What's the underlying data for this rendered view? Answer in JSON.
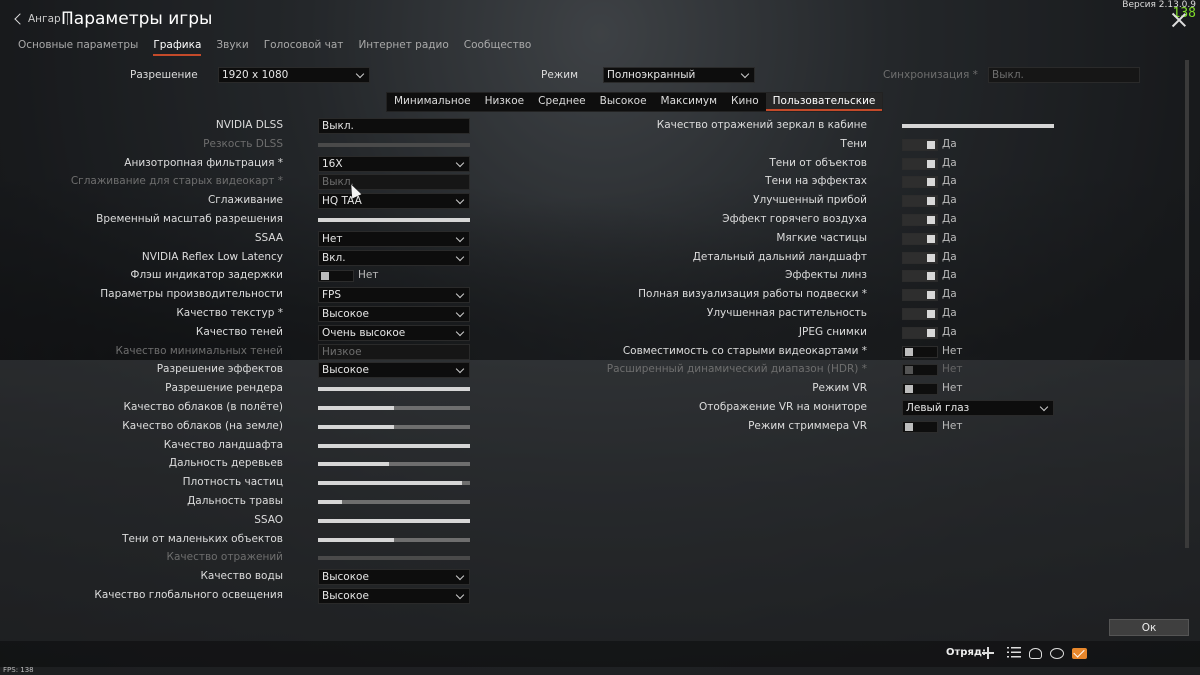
{
  "header": {
    "back_label": "Ангар",
    "title": "Параметры игры",
    "version": "Версия 2.13.0.9",
    "fps_counter": "138"
  },
  "tabs": [
    "Основные параметры",
    "Графика",
    "Звуки",
    "Голосовой чат",
    "Интернет радио",
    "Сообщество"
  ],
  "top_row": {
    "resolution_label": "Разрешение",
    "resolution_value": "1920 x 1080",
    "mode_label": "Режим",
    "mode_value": "Полноэкранный",
    "sync_label": "Синхронизация *",
    "sync_value": "Выкл."
  },
  "presets": [
    "Минимальное",
    "Низкое",
    "Среднее",
    "Высокое",
    "Максимум",
    "Кино",
    "Пользовательские"
  ],
  "left_settings": [
    {
      "label": "NVIDIA DLSS",
      "type": "field",
      "value": "Выкл."
    },
    {
      "label": "Резкость DLSS",
      "type": "slider",
      "value": 0,
      "disabled": true
    },
    {
      "label": "Анизотропная фильтрация *",
      "type": "dropdown",
      "value": "16X"
    },
    {
      "label": "Сглаживание для старых видеокарт *",
      "type": "field",
      "value": "Выкл.",
      "disabled": true
    },
    {
      "label": "Сглаживание",
      "type": "dropdown",
      "value": "HQ TAA"
    },
    {
      "label": "Временный масштаб разрешения",
      "type": "slider",
      "value": 1.0
    },
    {
      "label": "SSAA",
      "type": "dropdown",
      "value": "Нет"
    },
    {
      "label": "NVIDIA Reflex Low Latency",
      "type": "dropdown",
      "value": "Вкл."
    },
    {
      "label": "Флэш индикатор задержки",
      "type": "toggle",
      "value": "Нет",
      "on": false
    },
    {
      "label": "Параметры производительности",
      "type": "dropdown",
      "value": "FPS"
    },
    {
      "label": "Качество текстур *",
      "type": "dropdown",
      "value": "Высокое"
    },
    {
      "label": "Качество теней",
      "type": "dropdown",
      "value": "Очень высокое"
    },
    {
      "label": "Качество минимальных теней",
      "type": "field",
      "value": "Низкое",
      "disabled": true
    },
    {
      "label": "Разрешение эффектов",
      "type": "dropdown",
      "value": "Высокое"
    },
    {
      "label": "Разрешение рендера",
      "type": "slider",
      "value": 1.0
    },
    {
      "label": "Качество облаков (в полёте)",
      "type": "slider",
      "value": 0.5
    },
    {
      "label": "Качество облаков (на земле)",
      "type": "slider",
      "value": 0.5
    },
    {
      "label": "Качество ландшафта",
      "type": "slider",
      "value": 1.0
    },
    {
      "label": "Дальность деревьев",
      "type": "slider",
      "value": 0.47
    },
    {
      "label": "Плотность частиц",
      "type": "slider",
      "value": 0.95
    },
    {
      "label": "Дальность травы",
      "type": "slider",
      "value": 0.16
    },
    {
      "label": "SSAO",
      "type": "slider",
      "value": 1.0
    },
    {
      "label": "Тени от маленьких объектов",
      "type": "slider",
      "value": 0.5
    },
    {
      "label": "Качество отражений",
      "type": "slider",
      "value": 0,
      "disabled": true
    },
    {
      "label": "Качество воды",
      "type": "dropdown",
      "value": "Высокое"
    },
    {
      "label": "Качество глобального освещения",
      "type": "dropdown",
      "value": "Высокое"
    }
  ],
  "right_settings": [
    {
      "label": "Качество отражений зеркал в кабине",
      "type": "slider",
      "value": 1.0
    },
    {
      "label": "Тени",
      "type": "toggle",
      "value": "Да",
      "on": true
    },
    {
      "label": "Тени от объектов",
      "type": "toggle",
      "value": "Да",
      "on": true
    },
    {
      "label": "Тени на эффектах",
      "type": "toggle",
      "value": "Да",
      "on": true
    },
    {
      "label": "Улучшенный прибой",
      "type": "toggle",
      "value": "Да",
      "on": true
    },
    {
      "label": "Эффект горячего воздуха",
      "type": "toggle",
      "value": "Да",
      "on": true
    },
    {
      "label": "Мягкие частицы",
      "type": "toggle",
      "value": "Да",
      "on": true
    },
    {
      "label": "Детальный дальний ландшафт",
      "type": "toggle",
      "value": "Да",
      "on": true
    },
    {
      "label": "Эффекты линз",
      "type": "toggle",
      "value": "Да",
      "on": true
    },
    {
      "label": "Полная визуализация работы подвески *",
      "type": "toggle",
      "value": "Да",
      "on": true
    },
    {
      "label": "Улучшенная растительность",
      "type": "toggle",
      "value": "Да",
      "on": true
    },
    {
      "label": "JPEG снимки",
      "type": "toggle",
      "value": "Да",
      "on": true
    },
    {
      "label": "Совместимость со старыми видеокартами *",
      "type": "toggle",
      "value": "Нет",
      "on": false
    },
    {
      "label": "Расширенный динамический диапазон (HDR) *",
      "type": "toggle",
      "value": "Нет",
      "on": false,
      "disabled": true
    },
    {
      "label": "Режим VR",
      "type": "toggle",
      "value": "Нет",
      "on": false
    },
    {
      "label": "Отображение VR на мониторе",
      "type": "dropdown",
      "value": "Левый глаз"
    },
    {
      "label": "Режим стриммера VR",
      "type": "toggle",
      "value": "Нет",
      "on": false
    }
  ],
  "footer": {
    "ok_label": "Ок",
    "squad_label": "Отряд:",
    "fps_label": "FPS: 138",
    "icons": [
      "add-squad-icon",
      "list-icon",
      "friends-icon",
      "chat-icon",
      "mail-icon"
    ],
    "mail_color": "#e8872c"
  },
  "colors": {
    "accent": "#c44a2a",
    "fps_green": "#7fdc2a"
  }
}
